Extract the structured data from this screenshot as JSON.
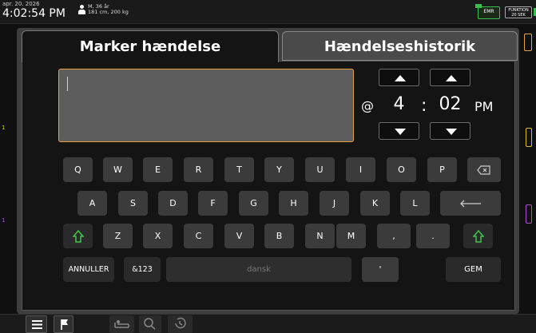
{
  "status": {
    "date": "apr. 20. 2026",
    "time": "4:02:54 PM",
    "patient_line1": "M, 36 år",
    "patient_line2": "181 cm, 200 kg",
    "emr_label": "EMR",
    "function_line1": "FUNKTION",
    "function_line2": "20 SEK"
  },
  "background": {
    "left_marker_1": "1",
    "left_marker_2": "1"
  },
  "tabs": {
    "active": "Marker hændelse",
    "inactive": "Hændelseshistorik"
  },
  "event": {
    "text_value": "",
    "at_symbol": "@",
    "hour": "4",
    "colon": ":",
    "minute": "02",
    "ampm": "PM"
  },
  "keyboard": {
    "row1": [
      "Q",
      "W",
      "E",
      "R",
      "T",
      "Y",
      "U",
      "I",
      "O",
      "P"
    ],
    "row2": [
      "A",
      "S",
      "D",
      "F",
      "G",
      "H",
      "J",
      "K",
      "L"
    ],
    "row3": [
      "Z",
      "X",
      "C",
      "V",
      "B",
      "N",
      "M",
      ",",
      "."
    ],
    "cancel": "ANNULLER",
    "symbols": "&123",
    "space": "dansk",
    "apostrophe": "'",
    "save": "GEM"
  },
  "colors": {
    "accent_orange": "#e9a23b",
    "shift_green": "#3ec84a",
    "emr_green": "#37c04c",
    "marker_yellow": "#d8c21a",
    "marker_purple": "#b04bd0"
  }
}
